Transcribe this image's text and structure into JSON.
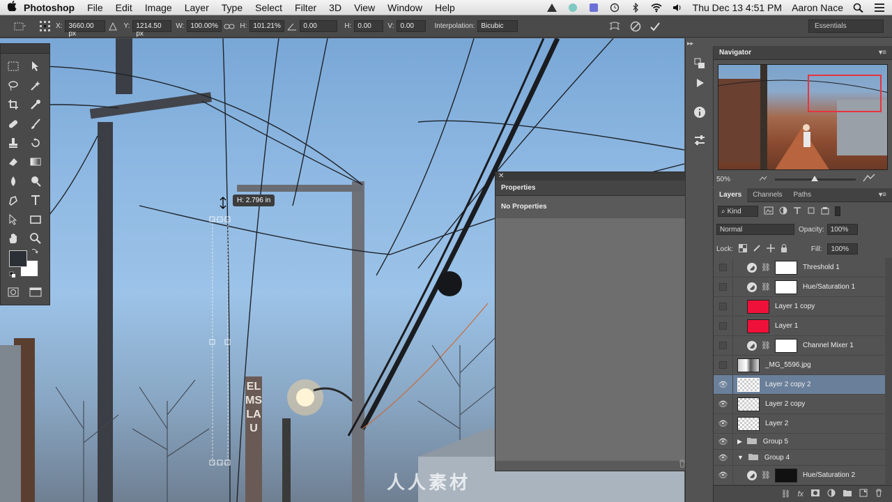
{
  "menubar": {
    "apple": "",
    "app_name": "Photoshop",
    "items": [
      "File",
      "Edit",
      "Image",
      "Layer",
      "Type",
      "Select",
      "Filter",
      "3D",
      "View",
      "Window",
      "Help"
    ],
    "clock": "Thu Dec 13  4:51 PM",
    "user": "Aaron Nace"
  },
  "options": {
    "x_label": "X:",
    "x_value": "3660.00 px",
    "y_label": "Y:",
    "y_value": "1214.50 px",
    "w_label": "W:",
    "w_value": "100.00%",
    "h_label": "H:",
    "h_value": "101.21%",
    "angle_value": "0.00",
    "hskew_label": "H:",
    "hskew_value": "0.00",
    "vskew_label": "V:",
    "vskew_value": "0.00",
    "interp_label": "Interpolation:",
    "interp_value": "Bicubic",
    "workspace": "Essentials"
  },
  "canvas": {
    "tooltip": "H: 2.796 in",
    "pole_sign": "ELMS LAU",
    "watermark": "人人素材"
  },
  "navigator": {
    "tab": "Navigator",
    "zoom": "50%"
  },
  "properties": {
    "tab": "Properties",
    "message": "No Properties"
  },
  "layers": {
    "tabs": [
      "Layers",
      "Channels",
      "Paths"
    ],
    "filter": "Kind",
    "blend_mode": "Normal",
    "opacity_label": "Opacity:",
    "opacity": "100%",
    "lock_label": "Lock:",
    "fill_label": "Fill:",
    "fill": "100%",
    "items": [
      {
        "name": "Threshold 1",
        "type": "adjustment",
        "visible": false
      },
      {
        "name": "Hue/Saturation 1",
        "type": "adjustment",
        "visible": false
      },
      {
        "name": "Layer 1 copy",
        "type": "red",
        "visible": false
      },
      {
        "name": "Layer 1",
        "type": "red",
        "visible": false
      },
      {
        "name": "Channel Mixer 1",
        "type": "adjustment",
        "visible": false
      },
      {
        "name": "_MG_5596.jpg",
        "type": "photo",
        "visible": false
      },
      {
        "name": "Layer 2 copy 2",
        "type": "transparent",
        "visible": true,
        "selected": true
      },
      {
        "name": "Layer 2 copy",
        "type": "transparent",
        "visible": true
      },
      {
        "name": "Layer 2",
        "type": "transparent",
        "visible": true
      },
      {
        "name": "Group 5",
        "type": "group-closed",
        "visible": true
      },
      {
        "name": "Group 4",
        "type": "group-open",
        "visible": true
      },
      {
        "name": "Hue/Saturation 2",
        "type": "adjustment-mask",
        "visible": true
      }
    ]
  },
  "colors": {
    "foreground": "#2b2f36",
    "background": "#ffffff",
    "layer_red": "#f0113a",
    "selection": "#6a7f9a"
  }
}
